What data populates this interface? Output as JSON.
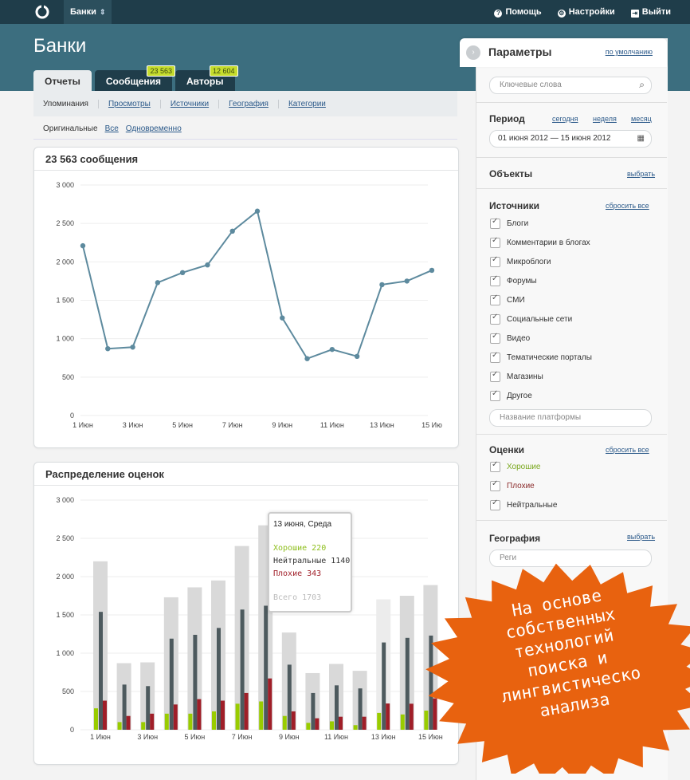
{
  "topbar": {
    "logo_icon": "logo-icon",
    "app": "Банки",
    "help": "Помощь",
    "settings": "Настройки",
    "logout": "Выйти"
  },
  "page": {
    "title": "Банки"
  },
  "tabs": [
    {
      "label": "Отчеты",
      "badge": ""
    },
    {
      "label": "Сообщения",
      "badge": "23 563"
    },
    {
      "label": "Авторы",
      "badge": "12 604"
    }
  ],
  "subnav": [
    "Упоминания",
    "Просмотры",
    "Источники",
    "География",
    "Категории"
  ],
  "subnav2": [
    "Оригинальные",
    "Все",
    "Одновременно"
  ],
  "panels": {
    "line_title": "23 563 сообщения",
    "bar_title": "Распределение оценок"
  },
  "chart_data": [
    {
      "type": "line",
      "title": "23 563 сообщения",
      "x": [
        "1 Июн",
        "2 Июн",
        "3 Июн",
        "4 Июн",
        "5 Июн",
        "6 Июн",
        "7 Июн",
        "8 Июн",
        "9 Июн",
        "10 Июн",
        "11 Июн",
        "12 Июн",
        "13 Июн",
        "14 Июн",
        "15 Июн"
      ],
      "x_ticks": [
        "1 Июн",
        "3 Июн",
        "5 Июн",
        "7 Июн",
        "9 Июн",
        "11 Июн",
        "13 Июн",
        "15 Ию"
      ],
      "values": [
        2210,
        870,
        890,
        1730,
        1860,
        1960,
        2400,
        2660,
        1270,
        740,
        860,
        770,
        1703,
        1750,
        1890
      ],
      "y_ticks": [
        "3 000",
        "2 500",
        "2 000",
        "1 500",
        "1 000",
        "500",
        "0"
      ],
      "ylim": [
        0,
        3000
      ],
      "color": "#5d8a9e",
      "grid": true
    },
    {
      "type": "bar",
      "title": "Распределение оценок",
      "categories": [
        "1 Июн",
        "2 Июн",
        "3 Июн",
        "4 Июн",
        "5 Июн",
        "6 Июн",
        "7 Июн",
        "8 Июн",
        "9 Июн",
        "10 Июн",
        "11 Июн",
        "12 Июн",
        "13 Июн",
        "14 Июн",
        "15 Июн"
      ],
      "x_ticks": [
        "1 Июн",
        "3 Июн",
        "5 Июн",
        "7 Июн",
        "9 Июн",
        "11 Июн",
        "13 Июн",
        "15 Июн"
      ],
      "y_ticks": [
        "3 000",
        "2 500",
        "2 000",
        "1 500",
        "1 000",
        "500",
        "0"
      ],
      "ylim": [
        0,
        3000
      ],
      "series": [
        {
          "name": "Всего",
          "color": "#d9d9d9",
          "values": [
            2200,
            870,
            880,
            1730,
            1860,
            1950,
            2400,
            2670,
            1270,
            740,
            860,
            770,
            1703,
            1750,
            1890
          ]
        },
        {
          "name": "Нейтральные",
          "color": "#4d5a5e",
          "values": [
            1540,
            590,
            570,
            1190,
            1240,
            1330,
            1570,
            1620,
            850,
            480,
            580,
            540,
            1140,
            1200,
            1230
          ]
        },
        {
          "name": "Хорошие",
          "color": "#99cc00",
          "values": [
            280,
            100,
            100,
            210,
            210,
            240,
            340,
            370,
            180,
            90,
            110,
            60,
            220,
            200,
            250
          ]
        },
        {
          "name": "Плохие",
          "color": "#a01e28",
          "values": [
            380,
            180,
            210,
            330,
            400,
            380,
            480,
            670,
            240,
            150,
            170,
            170,
            343,
            340,
            410
          ]
        }
      ],
      "highlight_index": 12,
      "tooltip": {
        "header": "13 июня, Среда",
        "good": "Хорошие 220",
        "neutral": "Нейтральные 1140",
        "bad": "Плохие 343",
        "total": "Всего 1703"
      }
    }
  ],
  "params": {
    "title": "Параметры",
    "default_link": "по умолчанию",
    "keywords_placeholder": "Ключевые слова",
    "period_title": "Период",
    "period_links": [
      "сегодня",
      "неделя",
      "месяц"
    ],
    "period_value": "01 июня 2012 — 15 июня 2012",
    "objects_title": "Объекты",
    "objects_link": "выбрать",
    "sources_title": "Источники",
    "sources_reset": "сбросить все",
    "sources": [
      "Блоги",
      "Комментарии в блогах",
      "Микроблоги",
      "Форумы",
      "СМИ",
      "Социальные сети",
      "Видео",
      "Тематические порталы",
      "Магазины",
      "Другое"
    ],
    "platform_placeholder": "Название платформы",
    "ratings_title": "Оценки",
    "ratings_reset": "сбросить все",
    "ratings": [
      "Хорошие",
      "Плохие",
      "Нейтральные"
    ],
    "geo_title": "География",
    "geo_link": "выбрать",
    "geo_placeholder": "Реги"
  },
  "promo": {
    "color": "#e8620f",
    "lines": [
      "На основе",
      "собственных",
      "технологий",
      "поиска и",
      "лингвистическо",
      "анализа"
    ]
  }
}
